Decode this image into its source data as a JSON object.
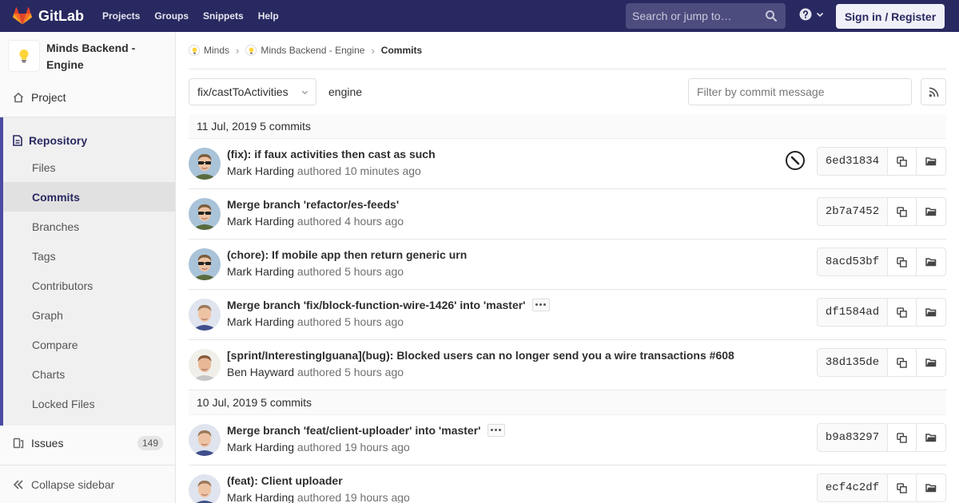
{
  "topbar": {
    "brand": "GitLab",
    "nav": [
      "Projects",
      "Groups",
      "Snippets",
      "Help"
    ],
    "search_placeholder": "Search or jump to…",
    "signin": "Sign in / Register"
  },
  "sidebar": {
    "project_title": "Minds Backend - Engine",
    "project_link": "Project",
    "repository": "Repository",
    "items": [
      "Files",
      "Commits",
      "Branches",
      "Tags",
      "Contributors",
      "Graph",
      "Compare",
      "Charts",
      "Locked Files"
    ],
    "active_item": "Commits",
    "issues_label": "Issues",
    "issues_count": "149",
    "collapse": "Collapse sidebar"
  },
  "breadcrumb": {
    "group": "Minds",
    "project": "Minds Backend - Engine",
    "current": "Commits"
  },
  "filterbar": {
    "branch": "fix/castToActivities",
    "path": "engine",
    "filter_placeholder": "Filter by commit message"
  },
  "days": [
    {
      "header": "11 Jul, 2019 5 commits",
      "commits": [
        {
          "title": "(fix): if faux activities then cast as such",
          "author": "Mark Harding",
          "time": "authored 10 minutes ago",
          "sha": "6ed31834",
          "avatar": "mark",
          "has_ellipsis": false,
          "status_icon": true
        },
        {
          "title": "Merge branch 'refactor/es-feeds'",
          "author": "Mark Harding",
          "time": "authored 4 hours ago",
          "sha": "2b7a7452",
          "avatar": "mark",
          "has_ellipsis": false,
          "status_icon": false
        },
        {
          "title": "(chore): If mobile app then return generic urn",
          "author": "Mark Harding",
          "time": "authored 5 hours ago",
          "sha": "8acd53bf",
          "avatar": "mark",
          "has_ellipsis": false,
          "status_icon": false
        },
        {
          "title": "Merge branch 'fix/block-function-wire-1426' into 'master'",
          "author": "Mark Harding",
          "time": "authored 5 hours ago",
          "sha": "df1584ad",
          "avatar": "mark2",
          "has_ellipsis": true,
          "status_icon": false
        },
        {
          "title": "[sprint/InterestingIguana](bug): Blocked users can no longer send you a wire transactions #608",
          "author": "Ben Hayward",
          "time": "authored 5 hours ago",
          "sha": "38d135de",
          "avatar": "ben",
          "has_ellipsis": false,
          "status_icon": false
        }
      ]
    },
    {
      "header": "10 Jul, 2019 5 commits",
      "commits": [
        {
          "title": "Merge branch 'feat/client-uploader' into 'master'",
          "author": "Mark Harding",
          "time": "authored 19 hours ago",
          "sha": "b9a83297",
          "avatar": "mark2",
          "has_ellipsis": true,
          "status_icon": false
        },
        {
          "title": "(feat): Client uploader",
          "author": "Mark Harding",
          "time": "authored 19 hours ago",
          "sha": "ecf4c2df",
          "avatar": "mark2",
          "has_ellipsis": false,
          "status_icon": false
        }
      ]
    }
  ],
  "colors": {
    "nav_bg": "#292961",
    "accent": "#4b4ba3",
    "gitlab_orange": "#fc6d26"
  },
  "icons": {
    "brand": "gitlab-tanuki-icon",
    "search": "search-icon",
    "help": "question-circle-icon",
    "rss": "rss-icon",
    "copy": "copy-icon",
    "browse": "folder-open-icon",
    "status": "no-status-icon"
  }
}
